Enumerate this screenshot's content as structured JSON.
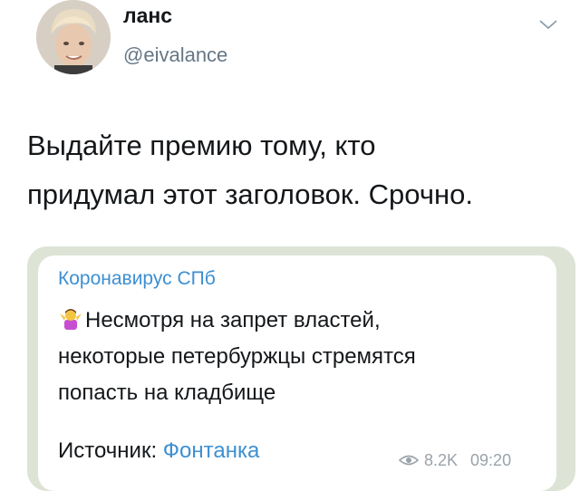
{
  "tweet": {
    "author_name": "ланс",
    "author_handle": "@eivalance",
    "text_line1": "Выдайте премию тому, кто",
    "text_line2": "придумал этот заголовок. Срочно.",
    "avatar_icon": "avatar-photo",
    "menu_icon": "chevron-down-icon"
  },
  "telegram_post": {
    "channel": "Коронавирус СПб",
    "emoji_icon": "shrugging-person-emoji",
    "line1": "Несмотря на запрет властей,",
    "line2": "некоторые петербуржцы стремятся",
    "line3": "попасть на кладбище",
    "source_label": "Источник:",
    "source_link": "Фонтанка",
    "views": "8.2K",
    "time": "09:20",
    "link_color": "#3d8fd1"
  }
}
